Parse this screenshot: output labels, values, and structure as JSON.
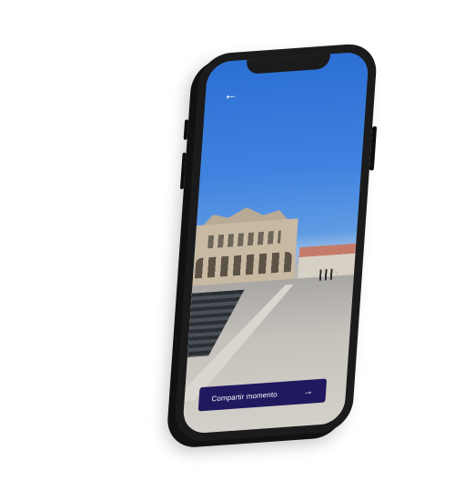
{
  "screen": {
    "back_icon": "arrow-left-icon",
    "cta": {
      "label": "Compartir momento",
      "icon": "arrow-right-icon",
      "color": "#20195e"
    }
  },
  "icons": {
    "back": "←",
    "forward": "→"
  }
}
